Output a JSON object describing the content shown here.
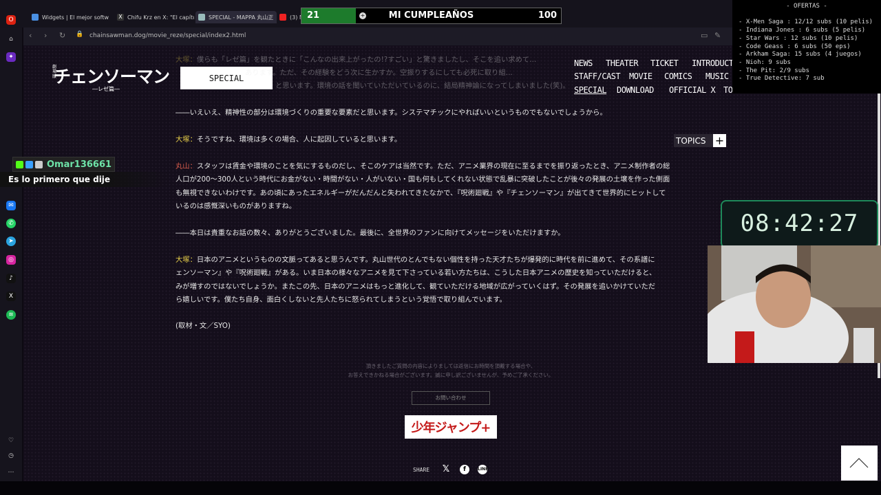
{
  "tabs": [
    {
      "label": "Widgets | El mejor softw",
      "color": "#4a90e2"
    },
    {
      "label": "Chifu Krz en X: \"El capítulo",
      "color": "#222"
    },
    {
      "label": "SPECIAL - MAPPA 丸山正",
      "color": "#9bb"
    },
    {
      "label": "(3) M",
      "color": "#e22"
    }
  ],
  "address": {
    "url": "chainsawman.dog/movie_reze/special/index2.html"
  },
  "site": {
    "logo_pre": "劇場版",
    "logo": "チェンソーマン",
    "logo_sub": "―レゼ篇―",
    "special_label": "SPECIAL"
  },
  "nav": [
    "NEWS",
    "THEATER",
    "TICKET",
    "INTRODUCTI",
    "STAFF/CAST",
    "MOVIE",
    "COMICS",
    "MUSIC",
    "SPECIAL",
    "DOWNLOAD",
    "OFFICIAL X",
    "TO"
  ],
  "topics": {
    "label": "TOPICS",
    "plus": "+"
  },
  "article": {
    "p0": {
      "speaker": "大塚：",
      "text": "僕らも「レゼ篇」を観たときに「こんなの出来上がったの!?すごい」と驚きましたし、そこを追い求めて…",
      "line2": "あります。ただ、その経験をどう次に生かすか。空振りするにしても必死に取り組…",
      "line3": "と思います。環境の話を聞いていただいているのに、結局精神論になってしまいました(笑)。"
    },
    "p1": "――いえいえ、精神性の部分は環境づくりの重要な要素だと思います。システマチックにやればいいというものでもないでしょうから。",
    "p2": {
      "speaker": "大塚：",
      "text": "そうですね、環境は多くの場合、人に起因していると思います。"
    },
    "p3": {
      "speaker": "丸山：",
      "l1": "スタッフは賃金や環境のことを気にするものだし、そこのケアは当然です。ただ、アニメ業界の現在に至るまでを振り返ったとき、アニメ制作者の総",
      "l2": "人口が200〜300人という時代にお金がない・時間がない・人がいない・国も何もしてくれない状態で乱暴に突破したことが後々の発展の土壌を作った側面",
      "l3": "も無視できないわけです。あの頃にあったエネルギーがだんだんと失われてきたなかで、『呪術廻戦』や『チェンソーマン』が出てきて世界的にヒットして",
      "l4": "いるのは感慨深いものがありますね。"
    },
    "p4": "――本日は貴重なお話の数々、ありがとうございました。最後に、全世界のファンに向けてメッセージをいただけますか。",
    "p5": {
      "speaker": "大塚：",
      "l1": "日本のアニメというものの文脈ってあると思うんです。丸山世代のとんでもない個性を持った天才たちが爆発的に時代を前に進めて、その系譜に",
      "l2": "ェンソーマン』や『呪術廻戦』がある。いま日本の様々なアニメを見て下さっている若い方たちは、こうした日本アニメの歴史を知っていただけると、",
      "l3": "みが増すのではないでしょうか。またこの先、日本のアニメはもっと進化して、観ていただける地域が広がっていくはず。その発展を追いかけていただ",
      "l4": "ら嬉しいです。僕たち自身、面白くしないと先人たちに怒られてしまうという覚悟で取り組んでいます。"
    },
    "credit": "(取材・文／SYO)"
  },
  "footer": {
    "disclaimer1": "頂きましたご質問の内容によりましては返信にお時間を頂戴する場合や、",
    "disclaimer2": "お答えできかねる場合がございます。誠に申し訳ございませんが、予めご了承ください。",
    "contact": "お問い合わせ",
    "jump": "少年ジャンプ+",
    "share": "SHARE"
  },
  "overlay": {
    "counter": {
      "left": "21",
      "title": "MI CUMPLEAÑOS",
      "right": "100",
      "progress": 0.21
    },
    "offers": {
      "title": "- OFERTAS -",
      "lines": [
        "- X-Men Saga : 12/12 subs (10 pelis)",
        "- Indiana Jones : 6 subs (5 pelis)",
        "- Star Wars : 12 subs (10 pelis)",
        "- Code Geass : 6 subs (50 eps)",
        "- Arkham Saga: 15 subs (4 juegos)",
        "- Nioh: 9 subs",
        "- The Pit: 2/9 subs",
        "- True Detective: 7 sub"
      ]
    },
    "chat": {
      "user": "Omar136661",
      "message": "Es lo primero que dije"
    },
    "timer": "08:42:27"
  }
}
